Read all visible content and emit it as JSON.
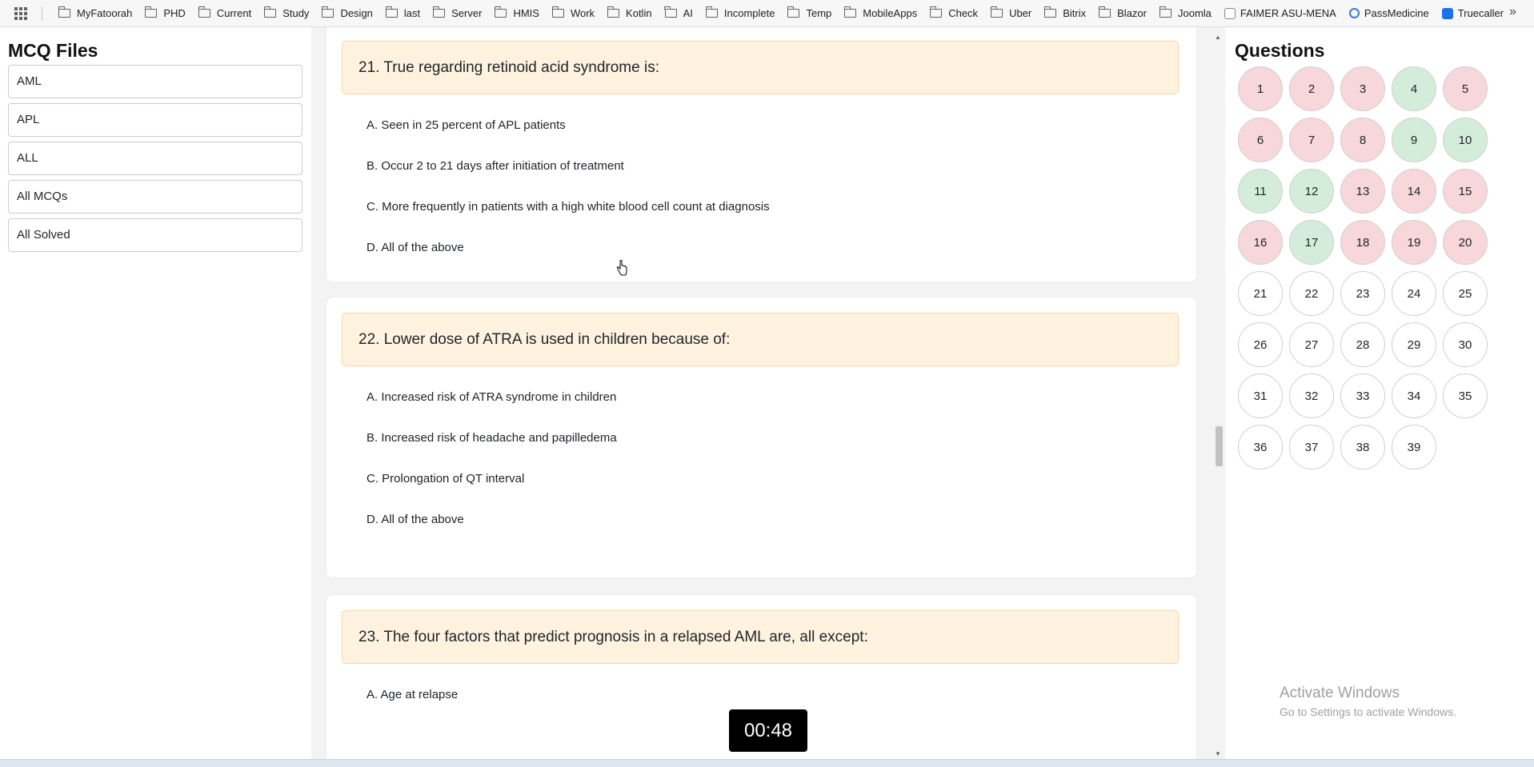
{
  "bookmarks": {
    "items": [
      {
        "label": "MyFatoorah",
        "icon": "folder-icon"
      },
      {
        "label": "PHD",
        "icon": "folder-icon"
      },
      {
        "label": "Current",
        "icon": "folder-icon"
      },
      {
        "label": "Study",
        "icon": "folder-icon"
      },
      {
        "label": "Design",
        "icon": "folder-icon"
      },
      {
        "label": "last",
        "icon": "folder-icon"
      },
      {
        "label": "Server",
        "icon": "folder-icon"
      },
      {
        "label": "HMIS",
        "icon": "folder-icon"
      },
      {
        "label": "Work",
        "icon": "folder-icon"
      },
      {
        "label": "Kotlin",
        "icon": "folder-icon"
      },
      {
        "label": "AI",
        "icon": "folder-icon"
      },
      {
        "label": "Incomplete",
        "icon": "folder-icon"
      },
      {
        "label": "Temp",
        "icon": "folder-icon"
      },
      {
        "label": "MobileApps",
        "icon": "folder-icon"
      },
      {
        "label": "Check",
        "icon": "folder-icon"
      },
      {
        "label": "Uber",
        "icon": "folder-icon"
      },
      {
        "label": "Bitrix",
        "icon": "folder-icon"
      },
      {
        "label": "Blazor",
        "icon": "folder-icon"
      },
      {
        "label": "Joomla",
        "icon": "folder-icon"
      }
    ],
    "sites": [
      {
        "label": "FAIMER ASU-MENA",
        "icon": "faimer-icon"
      },
      {
        "label": "PassMedicine",
        "icon": "passmedicine-icon"
      },
      {
        "label": "Truecaller",
        "icon": "truecaller-icon"
      }
    ],
    "more": "»"
  },
  "sidebar": {
    "title": "MCQ Files",
    "files": [
      "AML",
      "APL",
      "ALL",
      "All MCQs",
      "All Solved"
    ]
  },
  "questions": [
    {
      "title": "21. True regarding retinoid acid syndrome is:",
      "options": [
        "A. Seen in 25 percent of APL patients",
        "B. Occur 2 to 21 days after initiation of treatment",
        "C. More frequently in patients with a high white blood cell count at diagnosis",
        "D. All of the above"
      ]
    },
    {
      "title": "22. Lower dose of ATRA is used in children because of:",
      "options": [
        "A. Increased risk of ATRA syndrome in children",
        "B. Increased risk of headache and papilledema",
        "C. Prolongation of QT interval",
        "D. All of the above"
      ]
    },
    {
      "title": "23. The four factors that predict prognosis in a relapsed AML are, all except:",
      "options": [
        "A. Age at relapse"
      ]
    }
  ],
  "question_panel": {
    "title": "Questions",
    "buttons": [
      {
        "n": "1",
        "state": "wrong"
      },
      {
        "n": "2",
        "state": "wrong"
      },
      {
        "n": "3",
        "state": "wrong"
      },
      {
        "n": "4",
        "state": "right"
      },
      {
        "n": "5",
        "state": "wrong"
      },
      {
        "n": "6",
        "state": "wrong"
      },
      {
        "n": "7",
        "state": "wrong"
      },
      {
        "n": "8",
        "state": "wrong"
      },
      {
        "n": "9",
        "state": "right"
      },
      {
        "n": "10",
        "state": "right"
      },
      {
        "n": "11",
        "state": "right"
      },
      {
        "n": "12",
        "state": "right"
      },
      {
        "n": "13",
        "state": "wrong"
      },
      {
        "n": "14",
        "state": "wrong"
      },
      {
        "n": "15",
        "state": "wrong"
      },
      {
        "n": "16",
        "state": "wrong"
      },
      {
        "n": "17",
        "state": "right"
      },
      {
        "n": "18",
        "state": "wrong"
      },
      {
        "n": "19",
        "state": "wrong"
      },
      {
        "n": "20",
        "state": "wrong"
      },
      {
        "n": "21",
        "state": "none"
      },
      {
        "n": "22",
        "state": "none"
      },
      {
        "n": "23",
        "state": "none"
      },
      {
        "n": "24",
        "state": "none"
      },
      {
        "n": "25",
        "state": "none"
      },
      {
        "n": "26",
        "state": "none"
      },
      {
        "n": "27",
        "state": "none"
      },
      {
        "n": "28",
        "state": "none"
      },
      {
        "n": "29",
        "state": "none"
      },
      {
        "n": "30",
        "state": "none"
      },
      {
        "n": "31",
        "state": "none"
      },
      {
        "n": "32",
        "state": "none"
      },
      {
        "n": "33",
        "state": "none"
      },
      {
        "n": "34",
        "state": "none"
      },
      {
        "n": "35",
        "state": "none"
      },
      {
        "n": "36",
        "state": "none"
      },
      {
        "n": "37",
        "state": "none"
      },
      {
        "n": "38",
        "state": "none"
      },
      {
        "n": "39",
        "state": "none"
      }
    ]
  },
  "timer": "00:48",
  "watermark": {
    "line1": "Activate Windows",
    "line2": "Go to Settings to activate Windows."
  },
  "colors": {
    "wrong": "#f8d7da",
    "right": "#d4edda",
    "question_bg": "#fff3e0"
  }
}
